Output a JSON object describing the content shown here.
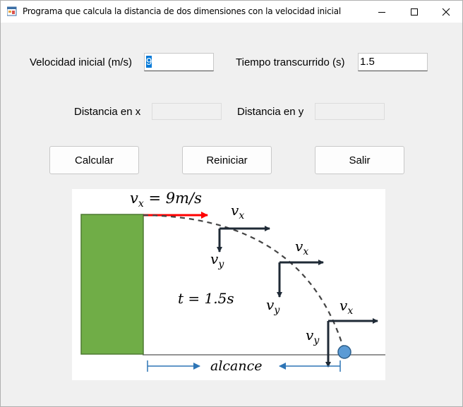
{
  "window": {
    "title": "Programa que calcula la distancia de dos dimensiones con la velocidad inicial",
    "controls": [
      "minimize-icon",
      "maximize-icon",
      "close-icon"
    ]
  },
  "form": {
    "velocity_label": "Velocidad inicial (m/s)",
    "velocity_value": "9",
    "time_label": "Tiempo transcurrido (s)",
    "time_value": "1.5",
    "distance_x_label": "Distancia en x",
    "distance_x_value": "",
    "distance_y_label": "Distancia en y",
    "distance_y_value": ""
  },
  "buttons": {
    "calculate": "Calcular",
    "reset": "Reiniciar",
    "exit": "Salir"
  },
  "diagram": {
    "vx_eq_lhs": "v",
    "vx_eq_sub": "x",
    "vx_eq_rhs": " = 9m/s",
    "time_eq": "t = 1.5s",
    "vx_label": "v",
    "vx_sub": "x",
    "vy_label": "v",
    "vy_sub": "y",
    "range_label": "alcance",
    "colors": {
      "wall": "#70ad47",
      "velocity_arrow": "#ff0000",
      "vectors": "#1f2a36",
      "ball": "#5b9bd5",
      "range_arrow": "#2e75b6"
    }
  }
}
